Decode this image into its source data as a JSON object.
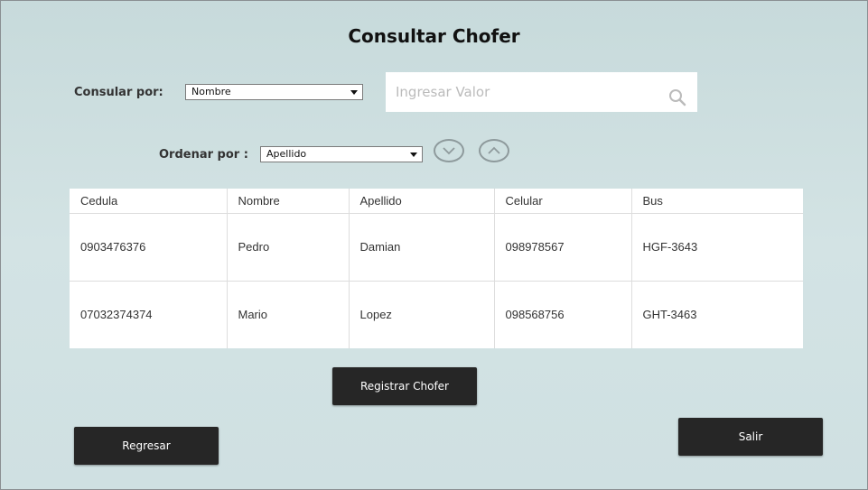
{
  "page": {
    "title": "Consultar Chofer"
  },
  "filters": {
    "consult_label": "Consular por:",
    "consult_value": "Nombre",
    "search_placeholder": "Ingresar Valor",
    "order_label": "Ordenar por :",
    "order_value": "Apellido",
    "icons": {
      "search": "search-icon",
      "sort_desc": "chevron-down-icon",
      "sort_asc": "chevron-up-icon"
    }
  },
  "table": {
    "columns": [
      "Cedula",
      "Nombre",
      "Apellido",
      "Celular",
      "Bus"
    ],
    "rows": [
      [
        "0903476376",
        "Pedro",
        "Damian",
        "098978567",
        "HGF-3643"
      ],
      [
        "07032374374",
        "Mario",
        "Lopez",
        "098568756",
        "GHT-3463"
      ]
    ]
  },
  "actions": {
    "register": "Registrar Chofer",
    "back": "Regresar",
    "exit": "Salir"
  },
  "colors": {
    "background": "#cfdfe0",
    "button": "#262626",
    "button_text": "#ffffff"
  }
}
